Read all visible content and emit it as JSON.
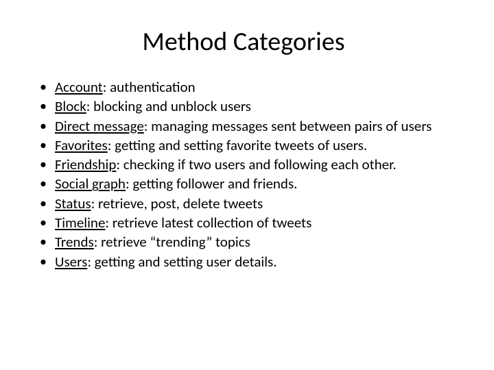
{
  "title": "Method Categories",
  "items": [
    {
      "term": "Account",
      "description": ":  authentication"
    },
    {
      "term": "Block",
      "description": ": blocking and unblock users"
    },
    {
      "term": "Direct message",
      "description": ": managing messages sent between pairs of users"
    },
    {
      "term": "Favorites",
      "description": ": getting and setting favorite tweets of users."
    },
    {
      "term": "Friendship",
      "description": ": checking if two users and following each other."
    },
    {
      "term": "Social graph",
      "description": ": getting follower and friends."
    },
    {
      "term": "Status",
      "description": ": retrieve, post, delete tweets"
    },
    {
      "term": "Timeline",
      "description": ": retrieve latest collection of tweets"
    },
    {
      "term": "Trends",
      "description": ": retrieve “trending” topics"
    },
    {
      "term": "Users",
      "description": ": getting and setting user details."
    }
  ]
}
